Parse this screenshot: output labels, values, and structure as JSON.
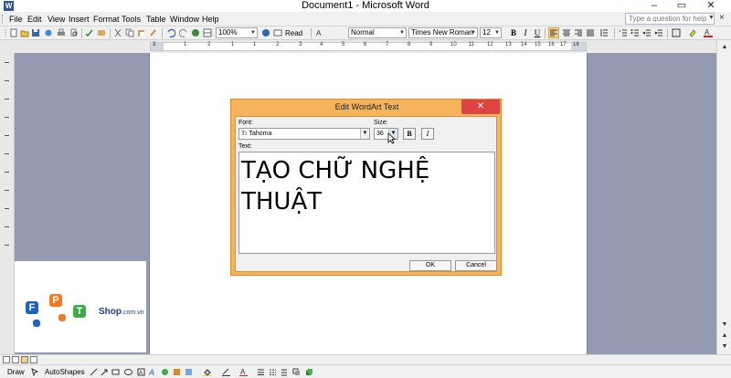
{
  "window": {
    "title": "Document1 - Microsoft Word",
    "minimize": "–",
    "maximize": "▭",
    "close": "✕"
  },
  "menubar": {
    "items": [
      "File",
      "Edit",
      "View",
      "Insert",
      "Format",
      "Tools",
      "Table",
      "Window",
      "Help"
    ],
    "help_placeholder": "Type a question for help",
    "doc_close": "×"
  },
  "toolbar": {
    "zoom": "100%",
    "read_label": "Read",
    "style": "Normal",
    "font": "Times New Roman",
    "size": "12",
    "bold": "B",
    "italic": "I",
    "underline": "U"
  },
  "ruler": {
    "labels": [
      "3",
      "1",
      "2",
      "1",
      "1",
      "2",
      "3",
      "4",
      "5",
      "6",
      "7",
      "8",
      "9",
      "10",
      "11",
      "12",
      "13",
      "14",
      "15",
      "16",
      "17",
      "18"
    ]
  },
  "drawbar": {
    "draw_label": "Draw",
    "autoshapes_label": "AutoShapes"
  },
  "dialog": {
    "title": "Edit WordArt Text",
    "font_label": "Font:",
    "font_value": "Tahoma",
    "size_label": "Size:",
    "size_value": "36",
    "bold": "B",
    "italic": "I",
    "text_label": "Text:",
    "text_value": "TẠO CHỮ NGHỆ\nTHUẬT",
    "ok": "OK",
    "cancel": "Cancel"
  },
  "logo": {
    "letters": [
      "F",
      "P",
      "T"
    ],
    "shop": "Shop",
    "domain": ".com.vn"
  },
  "colors": {
    "dialog_frame": "#f5b35e",
    "doc_background": "#949ab0",
    "close_red": "#e04343",
    "logo_blue": "#1c63c4",
    "logo_orange": "#f47a20",
    "logo_green": "#3aab47"
  }
}
